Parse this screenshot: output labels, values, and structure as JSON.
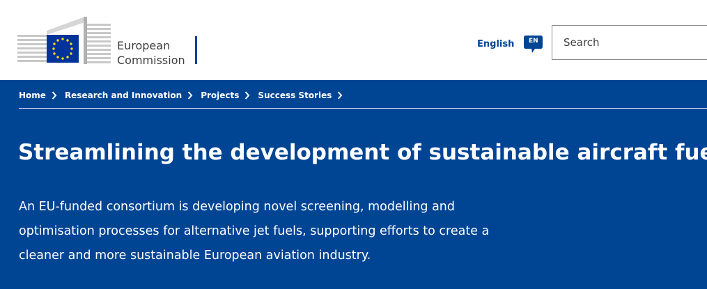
{
  "brand": {
    "line1": "European",
    "line2": "Commission",
    "colors": {
      "primary": "#004494",
      "star": "#ffd617",
      "flag": "#003399"
    }
  },
  "language": {
    "label": "English",
    "code": "EN"
  },
  "search": {
    "placeholder": "Search",
    "value": ""
  },
  "breadcrumb": [
    {
      "label": "Home"
    },
    {
      "label": "Research and Innovation"
    },
    {
      "label": "Projects"
    },
    {
      "label": "Success Stories"
    }
  ],
  "page": {
    "title": "Streamlining the development of sustainable aircraft fuels",
    "intro": "An EU-funded consortium is developing novel screening, modelling and optimisation processes for alternative jet fuels, supporting efforts to create a cleaner and more sustainable European aviation industry."
  },
  "icons": {
    "breadcrumb_separator": "chevron-right-icon",
    "language": "speech-bubble-icon"
  }
}
